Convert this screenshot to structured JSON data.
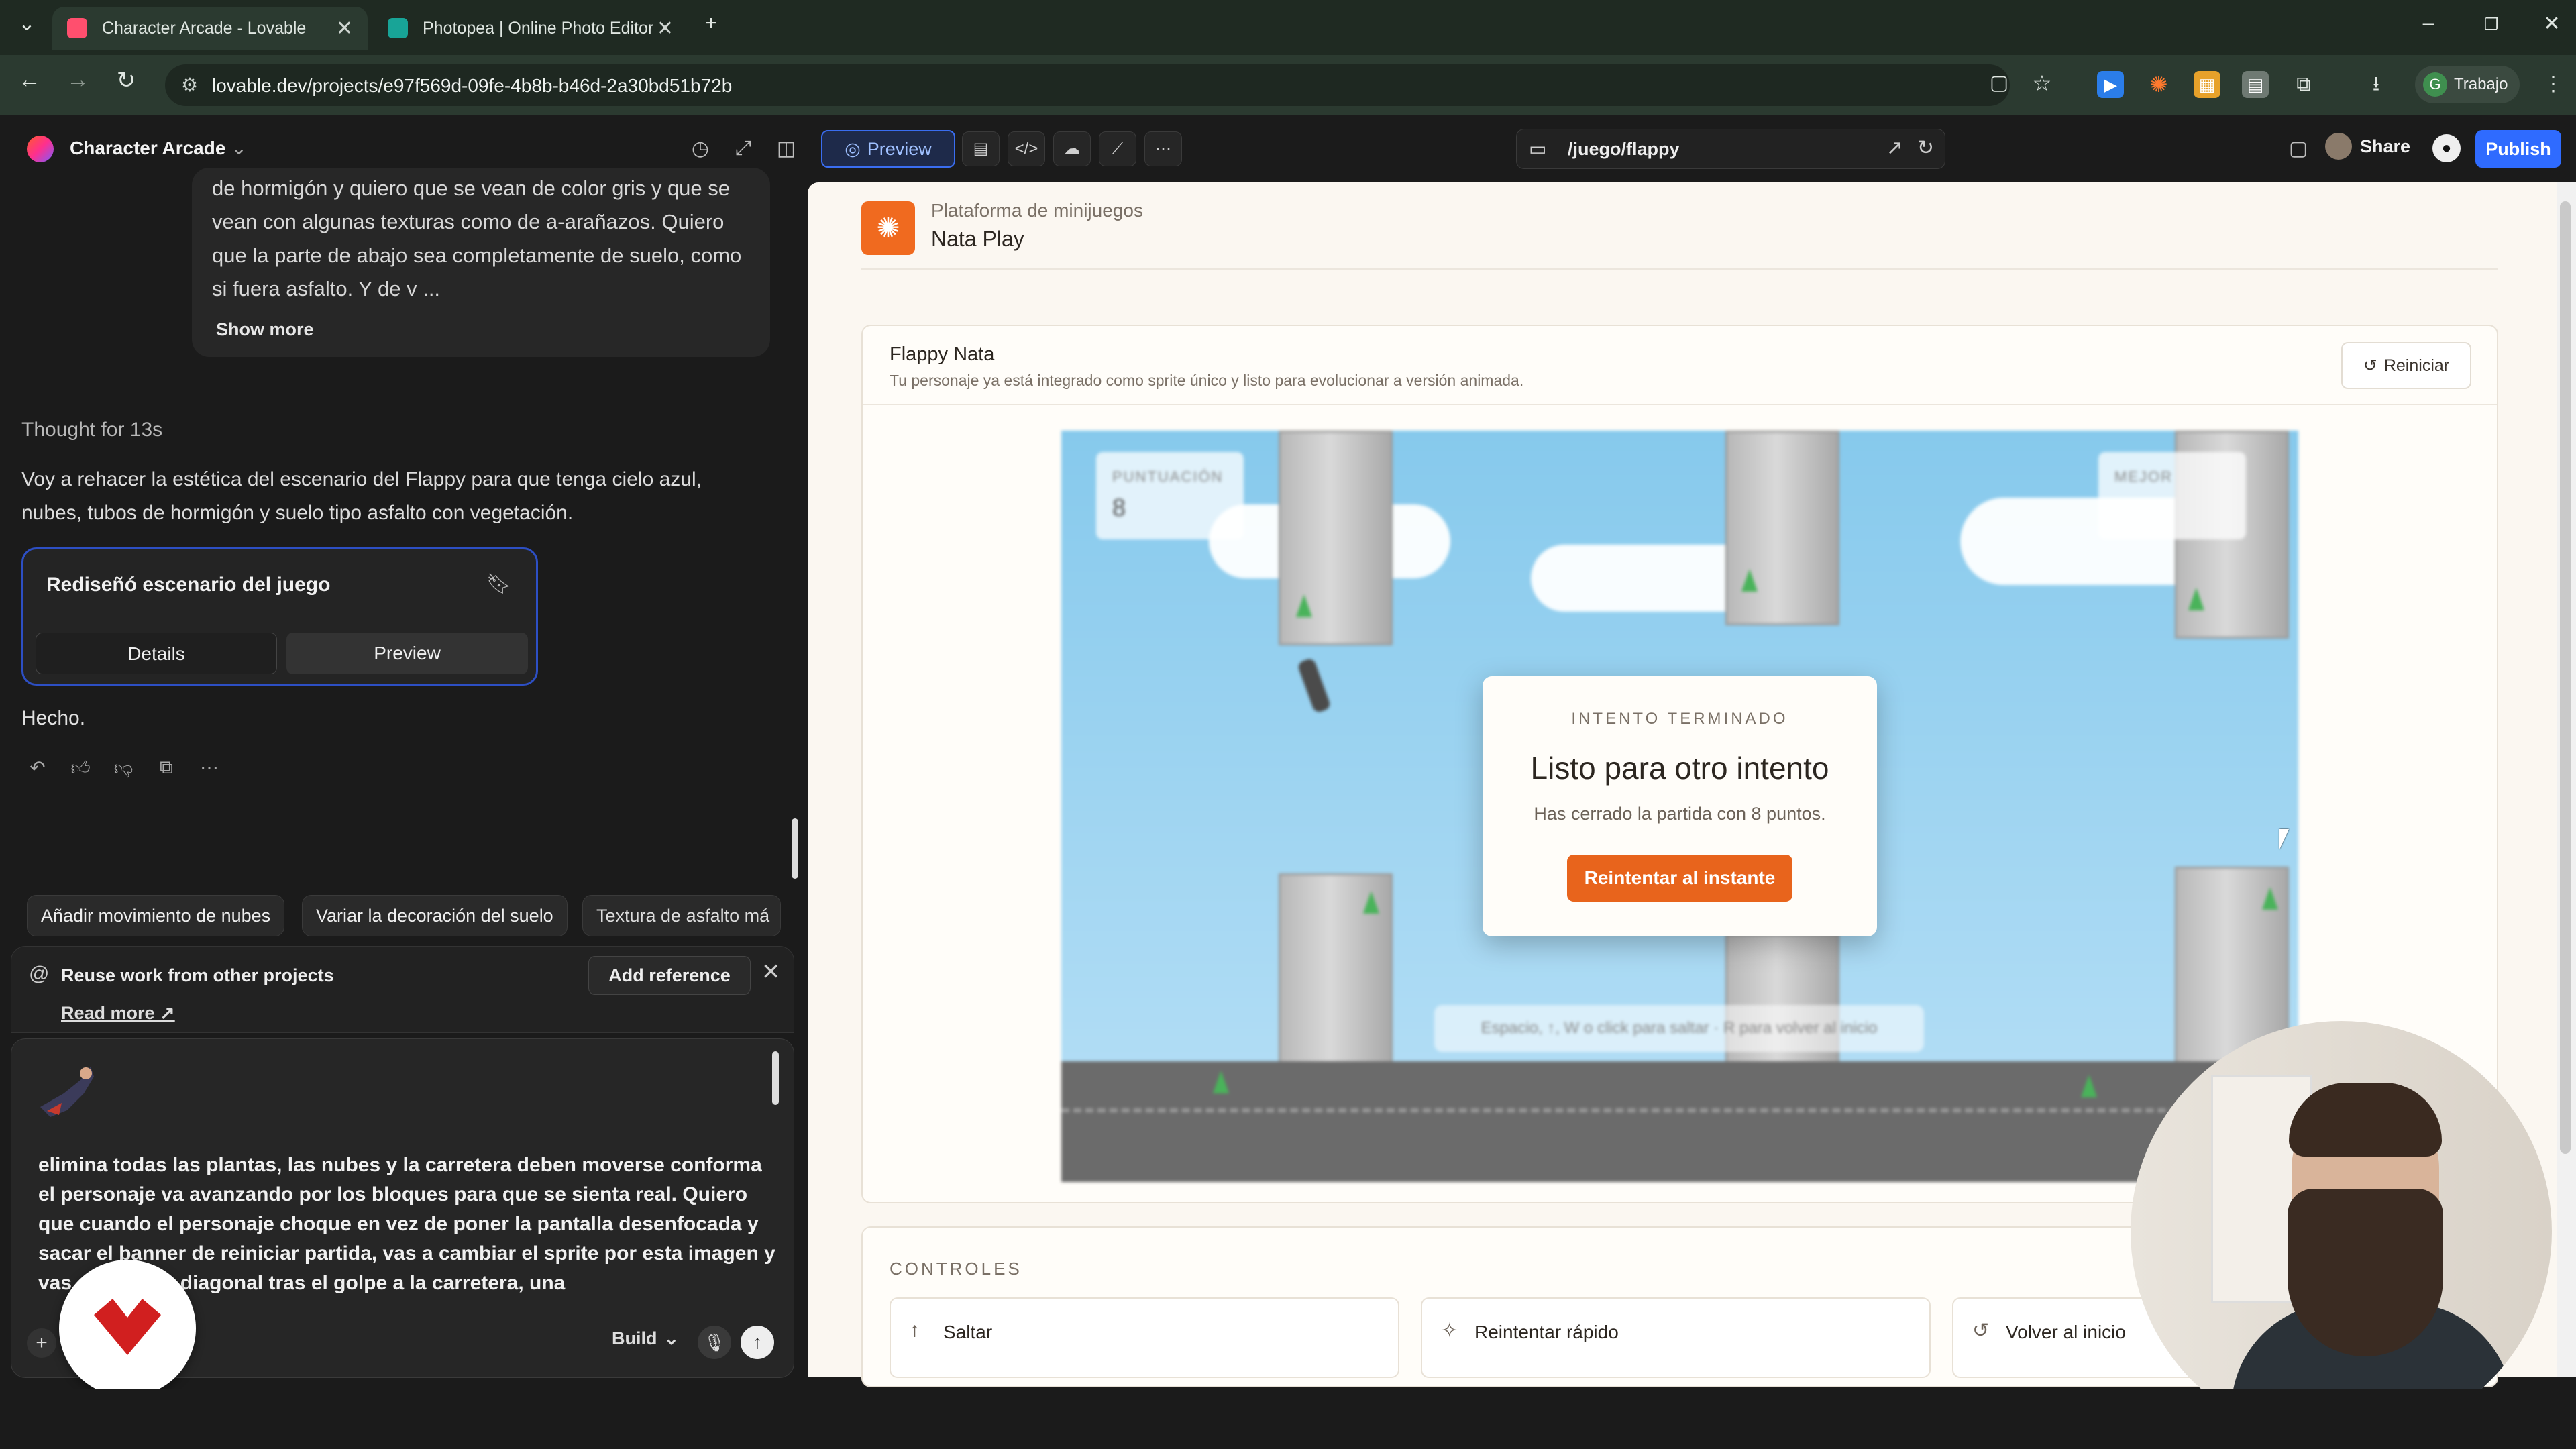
{
  "browser": {
    "tabs": [
      {
        "title": "Character Arcade - Lovable",
        "active": true,
        "favicon_color": "#ff4f6e"
      },
      {
        "title": "Photopea | Online Photo Editor",
        "active": false,
        "favicon_color": "#18a497"
      }
    ],
    "new_tab": "+",
    "url": "lovable.dev/projects/e97f569d-09fe-4b8b-b46d-2a30bd51b72b",
    "profile_label": "Trabajo",
    "profile_initial": "G",
    "window_controls": {
      "minimize": "–",
      "restore": "❐",
      "close": "✕"
    },
    "nav_icons": {
      "back": "←",
      "forward": "→",
      "reload": "↻"
    }
  },
  "app_header": {
    "project_name": "Character Arcade",
    "preview_label": "Preview",
    "route": "/juego/flappy",
    "share_label": "Share",
    "publish_label": "Publish"
  },
  "chat": {
    "user_message_tail": "de hormigón y quiero que se vean de color gris y que se vean con algunas texturas como de a-arañazos. Quiero que la parte de abajo sea completamente de suelo, como si fuera asfalto. Y de v ...",
    "show_more": "Show more",
    "thought": "Thought for 13s",
    "reply": "Voy a rehacer la estética del escenario del Flappy para que tenga cielo azul, nubes, tubos de hormigón y suelo tipo asfalto con vegetación.",
    "card": {
      "title": "Rediseñó escenario del juego",
      "details": "Details",
      "preview": "Preview"
    },
    "done": "Hecho.",
    "suggestions": [
      "Añadir movimiento de nubes",
      "Variar la decoración del suelo",
      "Textura de asfalto má"
    ],
    "reference": {
      "title": "Reuse work from other projects",
      "read_more": "Read more ↗",
      "add_button": "Add reference"
    },
    "composer_text": "elimina todas las plantas, las nubes y la carretera deben moverse conforma el personaje va avanzando por los bloques para que se sienta real. Quiero que cuando el personaje choque en vez de poner la pantalla desenfocada y sacar el banner de reiniciar partida, vas a cambiar el sprite por esta imagen y vas... caiga en diagonal tras el golpe a la carretera, una",
    "build_label": "Build"
  },
  "preview": {
    "platform": "Plataforma de minijuegos",
    "app_name": "Nata Play",
    "game_title": "Flappy Nata",
    "game_subtitle": "Tu personaje ya está integrado como sprite único y listo para evolucionar a versión animada.",
    "restart_label": "Reiniciar",
    "score_label": "PUNTUACIÓN",
    "score_value": "8",
    "best_label": "MEJOR",
    "hint": "Espacio, ↑, W o click para saltar · R para volver al inicio",
    "modal": {
      "label": "INTENTO TERMINADO",
      "title": "Listo para otro intento",
      "subtitle": "Has cerrado la partida con 8 puntos.",
      "button": "Reintentar al instante"
    },
    "controls_title": "CONTROLES",
    "controls": [
      {
        "icon": "↑",
        "label": "Saltar"
      },
      {
        "icon": "✧",
        "label": "Reintentar rápido"
      },
      {
        "icon": "↺",
        "label": "Volver al inicio"
      }
    ]
  },
  "colors": {
    "accent_orange": "#e8641c",
    "publish_blue": "#2f6bff",
    "sky": "#86c9ec"
  }
}
